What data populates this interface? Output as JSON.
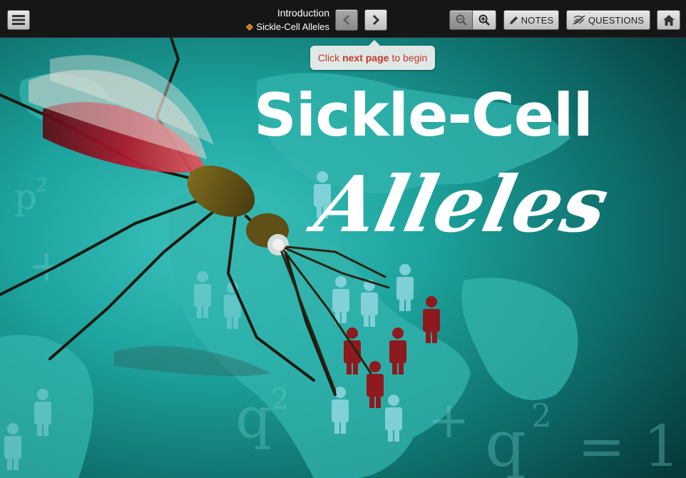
{
  "header": {
    "title": "Introduction",
    "subtitle": "Sickle-Cell Alleles",
    "menu_icon": "hamburger-menu-icon",
    "prev_icon": "chevron-left-icon",
    "next_icon": "chevron-right-icon",
    "zoom_out_icon": "zoom-out-icon",
    "zoom_in_icon": "zoom-in-icon",
    "notes_label": "NOTES",
    "questions_label": "QUESTIONS",
    "home_icon": "home-icon"
  },
  "tooltip": {
    "prefix": "Click",
    "emphasis": "next page",
    "suffix": "to begin"
  },
  "cover": {
    "title_line1": "Sickle-Cell",
    "title_line2": "Alleles",
    "equation_fragments": [
      "p",
      "2",
      "+",
      "q",
      "2",
      "+",
      "q",
      "2",
      "= 1"
    ]
  },
  "colors": {
    "topbar": "#161616",
    "accent_red": "#c0392b",
    "teal_bg": "#1a9a95",
    "person_light": "#8fd7e0",
    "person_red": "#8e1a1f"
  }
}
